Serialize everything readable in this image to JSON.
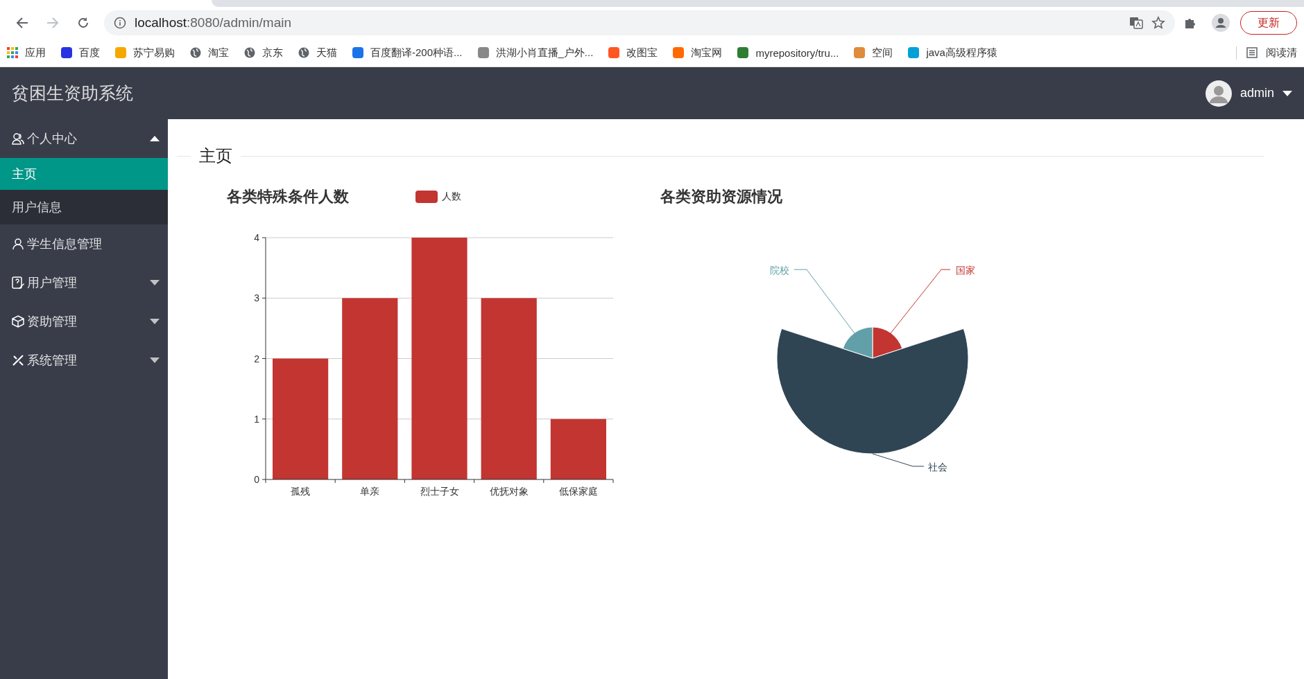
{
  "browser": {
    "url_host": "localhost",
    "url_rest": ":8080/admin/main",
    "update_button": "更新",
    "bookmarks": [
      {
        "label": "应用"
      },
      {
        "label": "百度"
      },
      {
        "label": "苏宁易购"
      },
      {
        "label": "淘宝"
      },
      {
        "label": "京东"
      },
      {
        "label": "天猫"
      },
      {
        "label": "百度翻译-200种语..."
      },
      {
        "label": "洪湖小肖直播_户外..."
      },
      {
        "label": "改图宝"
      },
      {
        "label": "淘宝网"
      },
      {
        "label": "myrepository/tru..."
      },
      {
        "label": "空间"
      },
      {
        "label": "java高级程序猿"
      }
    ],
    "reading_list": "阅读清"
  },
  "header": {
    "title": "贫困生资助系统",
    "user": "admin"
  },
  "sidebar": {
    "items": [
      {
        "label": "个人中心",
        "kind": "group",
        "expanded": true,
        "children": [
          {
            "label": "主页",
            "selected": true
          },
          {
            "label": "用户信息",
            "selected": false
          }
        ]
      },
      {
        "label": "学生信息管理",
        "kind": "link"
      },
      {
        "label": "用户管理",
        "kind": "group",
        "expanded": false
      },
      {
        "label": "资助管理",
        "kind": "group",
        "expanded": false
      },
      {
        "label": "系统管理",
        "kind": "group",
        "expanded": false
      }
    ]
  },
  "main": {
    "section_title": "主页",
    "bar_chart": {
      "chart_data": {
        "type": "bar",
        "title": "各类特殊条件人数",
        "categories": [
          "孤残",
          "单亲",
          "烈士子女",
          "优抚对象",
          "低保家庭"
        ],
        "series": [
          {
            "name": "人数",
            "color": "#c23531",
            "values": [
              2,
              3,
              4,
              3,
              1
            ]
          }
        ],
        "ylim": [
          0,
          4
        ],
        "grid": true,
        "yticks": [
          0,
          1,
          2,
          3,
          4
        ]
      }
    },
    "rose_chart": {
      "title": "各类资助资源情况",
      "slices": [
        {
          "label": "国家",
          "color": "#c23531"
        },
        {
          "label": "社会",
          "color": "#2f4554"
        },
        {
          "label": "院校",
          "color": "#61a0a8"
        }
      ]
    }
  }
}
